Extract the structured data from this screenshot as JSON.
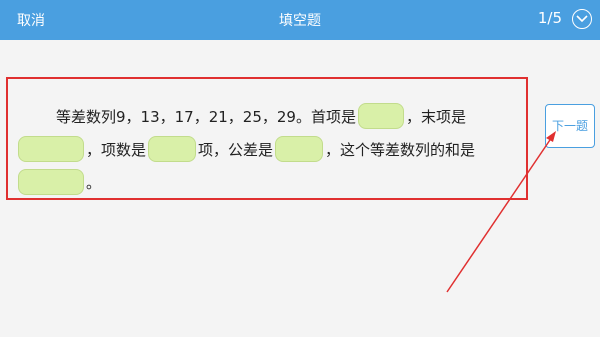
{
  "header": {
    "cancel_label": "取消",
    "title": "填空题",
    "counter": "1/5",
    "expand_icon": "chevron-down-icon"
  },
  "question": {
    "seg1": "等差数列9，13，17，21，25，29。首项是",
    "seg2": "，末项是",
    "seg3": "，项数是",
    "seg4": "项，公差是",
    "seg5": "，这个等差数列的和是",
    "seg6": "。"
  },
  "next_button": {
    "label": "下一题"
  },
  "colors": {
    "accent": "#4a9fe0",
    "highlight": "#e03030",
    "blank_fill": "#d9f0a8"
  }
}
